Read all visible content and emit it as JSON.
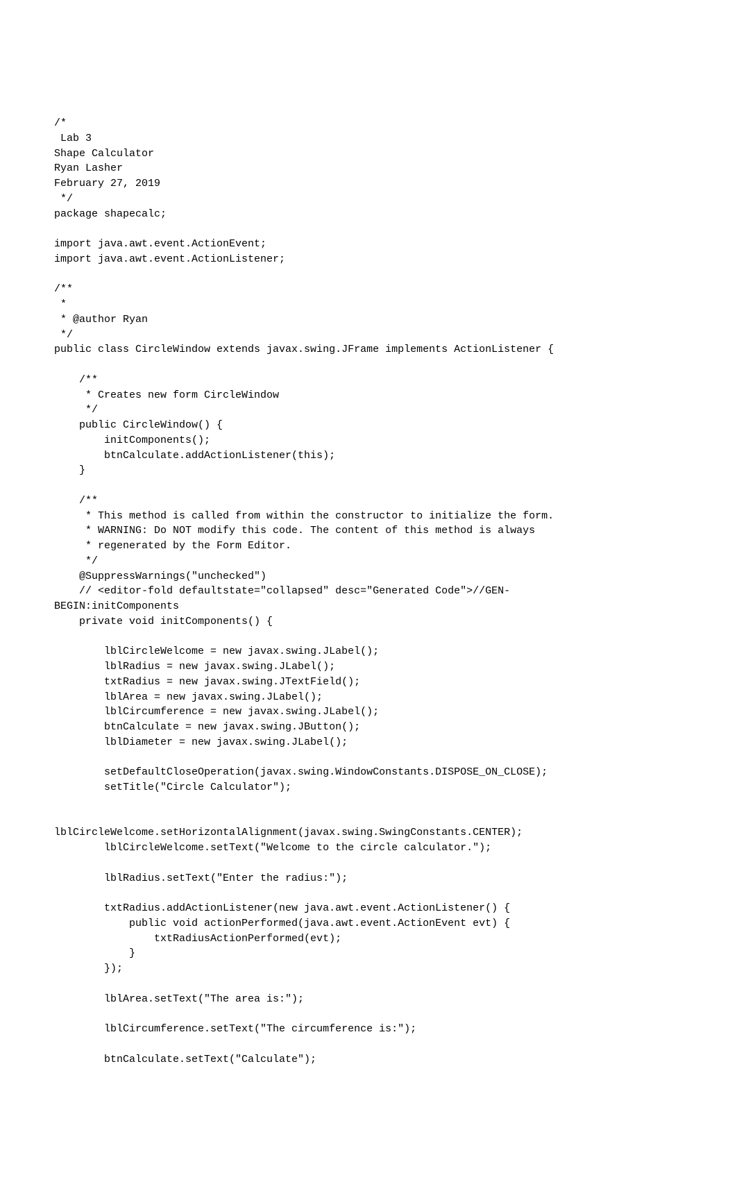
{
  "code": {
    "lines": [
      "/*",
      " Lab 3",
      "Shape Calculator",
      "Ryan Lasher",
      "February 27, 2019",
      " */",
      "package shapecalc;",
      "",
      "import java.awt.event.ActionEvent;",
      "import java.awt.event.ActionListener;",
      "",
      "/**",
      " *",
      " * @author Ryan",
      " */",
      "public class CircleWindow extends javax.swing.JFrame implements ActionListener {",
      "",
      "    /**",
      "     * Creates new form CircleWindow",
      "     */",
      "    public CircleWindow() {",
      "        initComponents();",
      "        btnCalculate.addActionListener(this);",
      "    }",
      "",
      "    /**",
      "     * This method is called from within the constructor to initialize the form.",
      "     * WARNING: Do NOT modify this code. The content of this method is always",
      "     * regenerated by the Form Editor.",
      "     */",
      "    @SuppressWarnings(\"unchecked\")",
      "    // <editor-fold defaultstate=\"collapsed\" desc=\"Generated Code\">//GEN-",
      "BEGIN:initComponents",
      "    private void initComponents() {",
      "",
      "        lblCircleWelcome = new javax.swing.JLabel();",
      "        lblRadius = new javax.swing.JLabel();",
      "        txtRadius = new javax.swing.JTextField();",
      "        lblArea = new javax.swing.JLabel();",
      "        lblCircumference = new javax.swing.JLabel();",
      "        btnCalculate = new javax.swing.JButton();",
      "        lblDiameter = new javax.swing.JLabel();",
      "",
      "        setDefaultCloseOperation(javax.swing.WindowConstants.DISPOSE_ON_CLOSE);",
      "        setTitle(\"Circle Calculator\");",
      "",
      "",
      "lblCircleWelcome.setHorizontalAlignment(javax.swing.SwingConstants.CENTER);",
      "        lblCircleWelcome.setText(\"Welcome to the circle calculator.\");",
      "",
      "        lblRadius.setText(\"Enter the radius:\");",
      "",
      "        txtRadius.addActionListener(new java.awt.event.ActionListener() {",
      "            public void actionPerformed(java.awt.event.ActionEvent evt) {",
      "                txtRadiusActionPerformed(evt);",
      "            }",
      "        });",
      "",
      "        lblArea.setText(\"The area is:\");",
      "",
      "        lblCircumference.setText(\"The circumference is:\");",
      "",
      "        btnCalculate.setText(\"Calculate\");"
    ]
  }
}
